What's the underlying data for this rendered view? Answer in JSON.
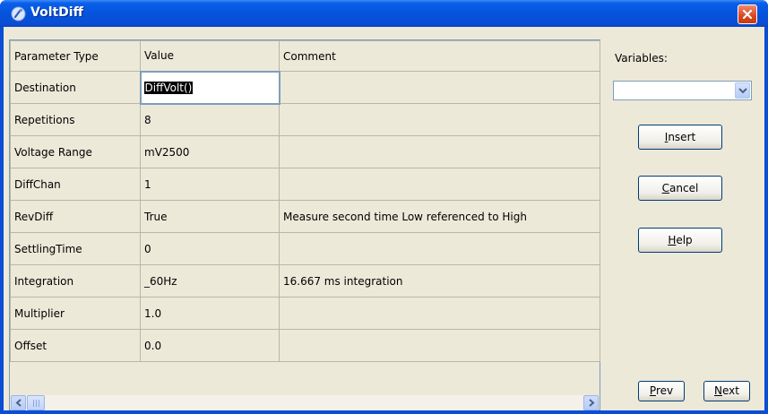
{
  "window": {
    "title": "VoltDiff"
  },
  "grid": {
    "columns": [
      "Parameter Type",
      "Value",
      "Comment"
    ],
    "rows": [
      {
        "param": "Destination",
        "value": "DiffVolt()",
        "comment": ""
      },
      {
        "param": "Repetitions",
        "value": "8",
        "comment": ""
      },
      {
        "param": "Voltage Range",
        "value": "mV2500",
        "comment": ""
      },
      {
        "param": "DiffChan",
        "value": "1",
        "comment": ""
      },
      {
        "param": "RevDiff",
        "value": "True",
        "comment": "Measure second time Low referenced to High"
      },
      {
        "param": "SettlingTime",
        "value": "0",
        "comment": ""
      },
      {
        "param": "Integration",
        "value": "_60Hz",
        "comment": "16.667 ms integration"
      },
      {
        "param": "Multiplier",
        "value": "1.0",
        "comment": ""
      },
      {
        "param": "Offset",
        "value": "0.0",
        "comment": ""
      }
    ]
  },
  "variables": {
    "label": "Variables:",
    "selected": ""
  },
  "buttons": {
    "insert": {
      "accel": "I",
      "rest": "nsert"
    },
    "cancel": {
      "accel": "C",
      "rest": "ancel"
    },
    "help": {
      "accel": "H",
      "rest": "elp"
    },
    "prev": {
      "accel": "P",
      "rest": "rev"
    },
    "next": {
      "accel": "N",
      "rest": "ext"
    }
  },
  "colors": {
    "titlebar": "#0a4ed6",
    "client": "#ece9d8",
    "close": "#d9471f"
  }
}
